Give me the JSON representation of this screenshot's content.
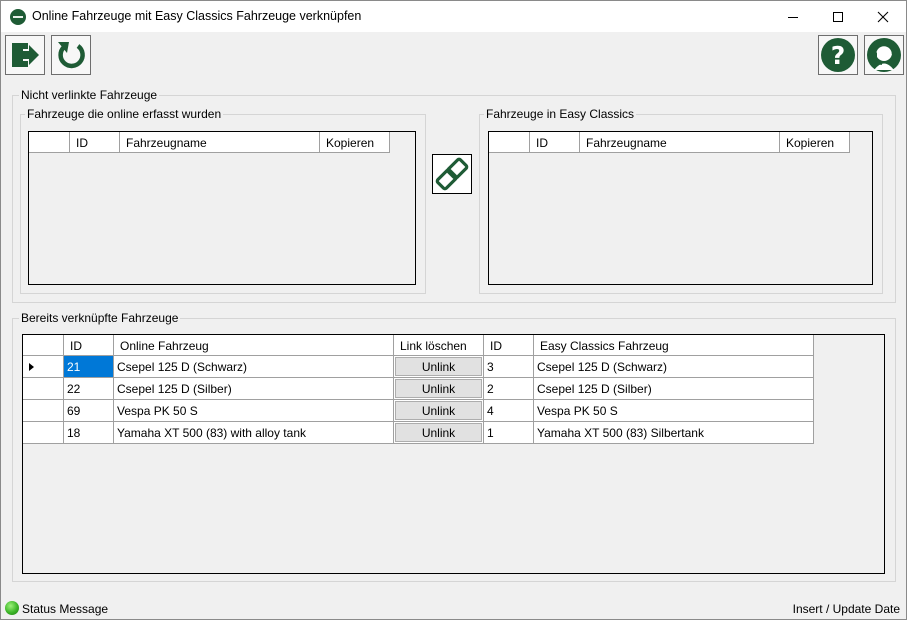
{
  "window": {
    "title": "Online Fahrzeuge mit Easy Classics Fahrzeuge verknüpfen"
  },
  "toolbar": {
    "exit_icon": "exit-arrow-icon",
    "refresh_icon": "refresh-icon",
    "help_icon": "help-icon",
    "support_icon": "support-headset-icon"
  },
  "unlinked": {
    "legend": "Nicht verlinkte Fahrzeuge",
    "online": {
      "legend": "Fahrzeuge die online erfasst wurden",
      "columns": [
        "",
        "ID",
        "Fahrzeugname",
        "Kopieren"
      ]
    },
    "easy": {
      "legend": "Fahrzeuge in Easy Classics",
      "columns": [
        "",
        "ID",
        "Fahrzeugname",
        "Kopieren"
      ]
    },
    "link_icon": "chain-link-icon"
  },
  "linked": {
    "legend": "Bereits verknüpfte Fahrzeuge",
    "columns": [
      "",
      "ID",
      "Online Fahrzeug",
      "Link löschen",
      "ID",
      "Easy Classics Fahrzeug"
    ],
    "unlink_label": "Unlink",
    "rows": [
      {
        "id": "21",
        "online": "Csepel 125 D (Schwarz)",
        "ec_id": "3",
        "ec": "Csepel 125 D (Schwarz)"
      },
      {
        "id": "22",
        "online": "Csepel 125 D (Silber)",
        "ec_id": "2",
        "ec": "Csepel 125 D (Silber)"
      },
      {
        "id": "69",
        "online": "Vespa PK 50 S",
        "ec_id": "4",
        "ec": "Vespa PK 50 S"
      },
      {
        "id": "18",
        "online": "Yamaha XT 500 (83) with alloy tank",
        "ec_id": "1",
        "ec": "Yamaha XT 500 (83) Silbertank"
      }
    ]
  },
  "status": {
    "message": "Status Message",
    "date_label": "Insert / Update Date"
  },
  "colors": {
    "brand_green": "#1e5b35",
    "selection": "#0078d7"
  }
}
